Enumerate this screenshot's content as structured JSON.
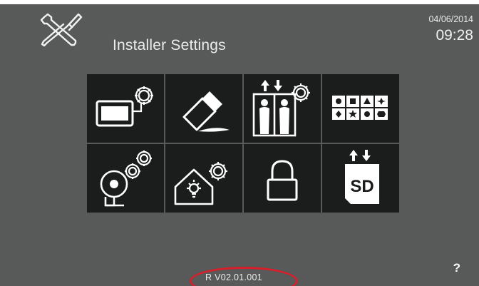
{
  "header": {
    "logo_icon": "tools-icon",
    "title": "Installer Settings",
    "date": "04/06/2014",
    "time": "09:28"
  },
  "menu": {
    "tiles": [
      {
        "icon": "monitor-settings-icon"
      },
      {
        "icon": "eraser-icon"
      },
      {
        "icon": "lift-settings-icon"
      },
      {
        "icon": "symbols-keypad-icon"
      },
      {
        "icon": "bell-settings-icon"
      },
      {
        "icon": "home-automation-settings-icon"
      },
      {
        "icon": "padlock-icon"
      },
      {
        "icon": "sd-card-transfer-icon"
      }
    ]
  },
  "footer": {
    "version": "R V02.01.001",
    "help": "?"
  },
  "colors": {
    "background": "#585a5a",
    "tile": "#1b1d1d",
    "icon": "#ffffff",
    "highlight": "#d81e2a"
  }
}
